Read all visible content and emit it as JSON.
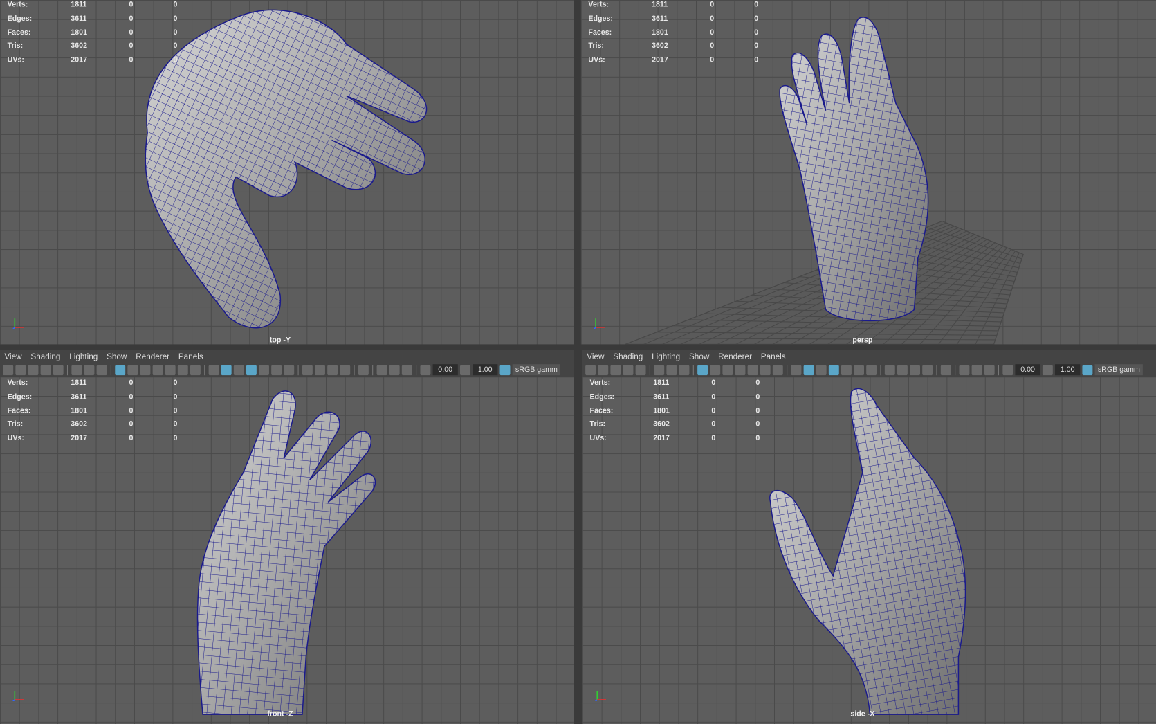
{
  "menus": [
    "View",
    "Shading",
    "Lighting",
    "Show",
    "Renderer",
    "Panels"
  ],
  "toolbar": {
    "exposure": "0.00",
    "gamma": "1.00",
    "color_space": "sRGB gamm"
  },
  "hud": {
    "rows": [
      {
        "label": "Verts:",
        "value": "1811",
        "a": "0",
        "b": "0"
      },
      {
        "label": "Edges:",
        "value": "3611",
        "a": "0",
        "b": "0"
      },
      {
        "label": "Faces:",
        "value": "1801",
        "a": "0",
        "b": "0"
      },
      {
        "label": "Tris:",
        "value": "3602",
        "a": "0",
        "b": "0"
      },
      {
        "label": "UVs:",
        "value": "2017",
        "a": "0",
        "b": "0"
      }
    ]
  },
  "viewports": [
    {
      "camera": "top -Y"
    },
    {
      "camera": "persp"
    },
    {
      "camera": "front -Z"
    },
    {
      "camera": "side -X"
    }
  ],
  "colors": {
    "wireframe": "#1a1a8c",
    "mesh": "#a8a8a8",
    "viewport_bg": "#5d5d5d",
    "grid": "#4a4a4a",
    "active_icon": "#5aa6c8"
  }
}
